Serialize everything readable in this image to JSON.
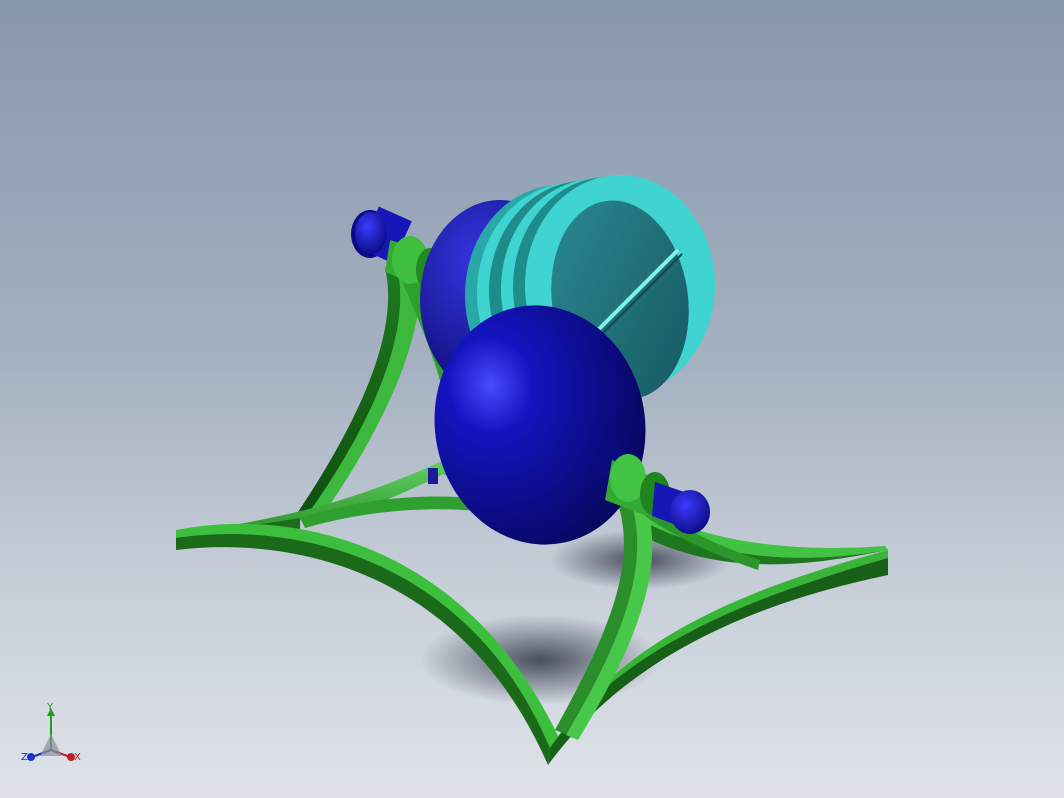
{
  "viewport": {
    "background_top": "#8797ad",
    "background_bottom": "#dfe3e9"
  },
  "model": {
    "frame_color": "#2e9a2e",
    "housing_color": "#1a1aa8",
    "end_cap_color": "#1f1fc4",
    "fin_color": "#3fd4d0",
    "fin_face_color": "#1e6f78",
    "collar_color": "#33a833"
  },
  "triad": {
    "x_label": "X",
    "y_label": "Y",
    "z_label": "Z",
    "x_color": "#c0202a",
    "y_color": "#20a020",
    "z_color": "#2030c0"
  }
}
